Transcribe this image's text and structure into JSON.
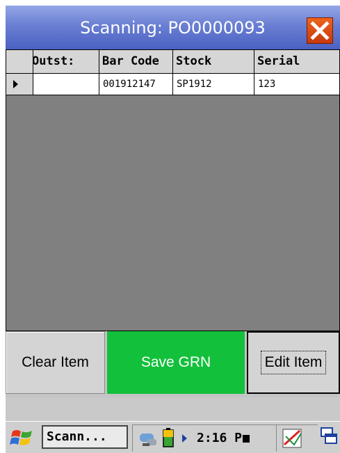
{
  "window": {
    "title": "Scanning: PO0000093"
  },
  "grid": {
    "columns": [
      {
        "label": "Outst:"
      },
      {
        "label": "Bar Code"
      },
      {
        "label": "Stock"
      },
      {
        "label": "Serial"
      }
    ],
    "rows": [
      {
        "outstanding": "",
        "barcode": "001912147",
        "stock": "SP1912",
        "serial": "123"
      }
    ]
  },
  "buttons": {
    "clear": "Clear Item",
    "save": "Save GRN",
    "edit": "Edit Item"
  },
  "taskbar": {
    "task_label": "Scann...",
    "clock": "2:16 P"
  },
  "colors": {
    "save_button": "#13c03b",
    "title_bar": "#6a7fd3",
    "close_button": "#e05a1c"
  },
  "icons": [
    "close-icon",
    "row-pointer-icon",
    "scroll-left-icon",
    "scroll-right-icon",
    "windows-start-icon",
    "network-icon",
    "battery-icon",
    "tray-expand-icon",
    "input-panel-icon",
    "switch-windows-icon"
  ]
}
